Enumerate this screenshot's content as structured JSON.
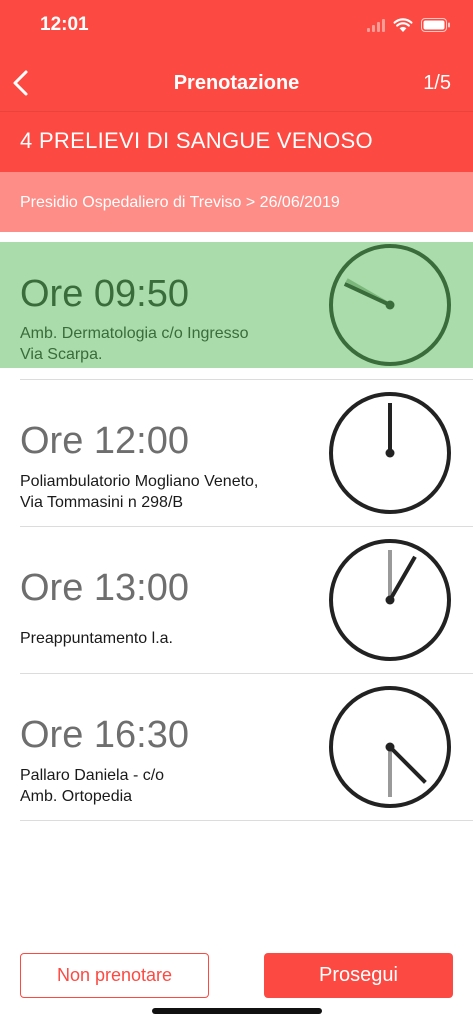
{
  "status": {
    "time": "12:01"
  },
  "nav": {
    "title": "Prenotazione",
    "step": "1/5"
  },
  "exam": {
    "title": "4 PRELIEVI DI SANGUE VENOSO"
  },
  "location": {
    "path": "Presidio Ospedaliero di Treviso > 26/06/2019"
  },
  "slots": [
    {
      "time": "Ore 09:50",
      "place": "Amb. Dermatologia c/o Ingresso\nVia Scarpa.",
      "selected": true,
      "hour": 9,
      "minute": 50
    },
    {
      "time": "Ore 12:00",
      "place": "Poliambulatorio Mogliano Veneto,\nVia Tommasini n 298/B",
      "selected": false,
      "hour": 12,
      "minute": 0
    },
    {
      "time": "Ore 13:00",
      "place": "Preappuntamento l.a.",
      "selected": false,
      "hour": 13,
      "minute": 0
    },
    {
      "time": "Ore 16:30",
      "place": "Pallaro Daniela - c/o\nAmb. Ortopedia",
      "selected": false,
      "hour": 16,
      "minute": 30
    }
  ],
  "buttons": {
    "skip": "Non prenotare",
    "next": "Prosegui"
  },
  "colors": {
    "accent": "#fc4a42",
    "accent_light": "#fd8d86",
    "selected_bg": "#aadbaa",
    "selected_fg": "#3a6b3a"
  }
}
